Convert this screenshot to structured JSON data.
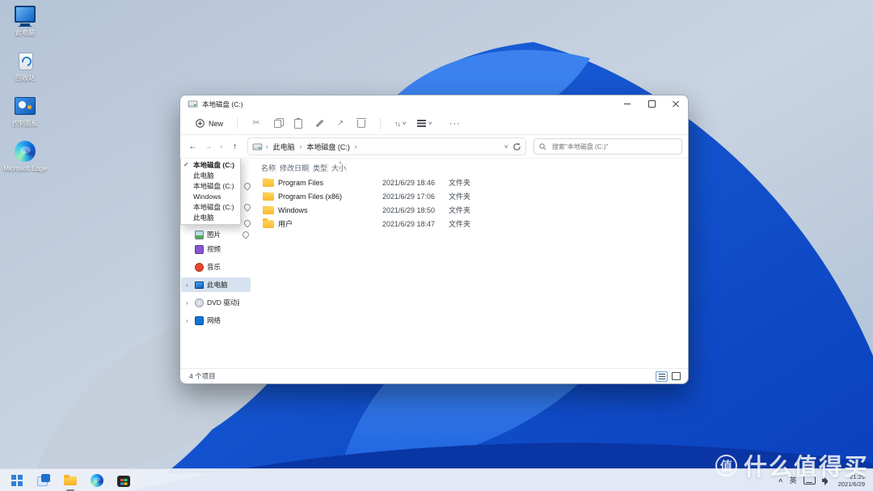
{
  "icons": {
    "check": "✓",
    "back": "←",
    "forward": "→",
    "up": "↑",
    "chevron_down": "∨",
    "chevron_right": "›",
    "chevron_up": "∧",
    "more": "···",
    "scissors": "✂",
    "share_arrow": "↗",
    "sort_arrows": "↑↓",
    "sort_asc_caret": "∧"
  },
  "desktop": {
    "icons": [
      {
        "label": "此电脑",
        "icon": "this-pc-icon"
      },
      {
        "label": "回收站",
        "icon": "recycle-bin-icon"
      },
      {
        "label": "控制面板",
        "icon": "control-panel-icon"
      },
      {
        "label": "Microsoft Edge",
        "icon": "edge-icon"
      }
    ]
  },
  "explorer": {
    "title": "本地磁盘 (C:)",
    "toolbar": {
      "new_label": "New"
    },
    "addressbar": {
      "breadcrumb_segments": [
        "此电脑",
        "本地磁盘 (C:)"
      ],
      "search_placeholder": "搜索\"本地磁盘 (C:)\""
    },
    "history_dropdown": {
      "items": [
        {
          "label": "本地磁盘 (C:)",
          "checked": true
        },
        {
          "label": "此电脑",
          "checked": false
        },
        {
          "label": "本地磁盘 (C:)",
          "checked": false
        },
        {
          "label": "Windows",
          "checked": false
        },
        {
          "label": "本地磁盘 (C:)",
          "checked": false
        },
        {
          "label": "此电脑",
          "checked": false
        }
      ]
    },
    "navigation": {
      "items": [
        {
          "label": "图片",
          "icon": "pictures",
          "pinned": true,
          "selected": false,
          "expander": false
        },
        {
          "label": "视频",
          "icon": "videos",
          "pinned": false,
          "selected": false,
          "expander": false
        },
        {
          "label": "音乐",
          "icon": "music",
          "pinned": false,
          "selected": false,
          "expander": false
        },
        {
          "label": "此电脑",
          "icon": "this-pc",
          "pinned": false,
          "selected": true,
          "expander": true
        },
        {
          "label": "DVD 驱动器 (D:) CP",
          "icon": "dvd",
          "pinned": false,
          "selected": false,
          "expander": true
        },
        {
          "label": "网络",
          "icon": "network",
          "pinned": false,
          "selected": false,
          "expander": true
        }
      ]
    },
    "file_list": {
      "columns": [
        "名称",
        "修改日期",
        "类型",
        "大小"
      ],
      "rows": [
        {
          "name": "Program Files",
          "date": "2021/6/29 18:46",
          "type": "文件夹",
          "size": ""
        },
        {
          "name": "Program Files (x86)",
          "date": "2021/6/29 17:06",
          "type": "文件夹",
          "size": ""
        },
        {
          "name": "Windows",
          "date": "2021/6/29 18:50",
          "type": "文件夹",
          "size": ""
        },
        {
          "name": "用户",
          "date": "2021/6/29 18:47",
          "type": "文件夹",
          "size": ""
        }
      ]
    },
    "statusbar": {
      "items_count": "4 个项目"
    }
  },
  "taskbar": {
    "buttons": [
      {
        "icon": "start",
        "active": false
      },
      {
        "icon": "task-view",
        "active": false
      },
      {
        "icon": "file-explorer",
        "active": true
      },
      {
        "icon": "edge",
        "active": false
      },
      {
        "icon": "store",
        "active": false
      }
    ],
    "tray": {
      "ime_label": "英",
      "time": "21:29",
      "date": "2021/6/29"
    }
  },
  "watermark": {
    "logo_char": "值",
    "text": "什么值得买"
  }
}
